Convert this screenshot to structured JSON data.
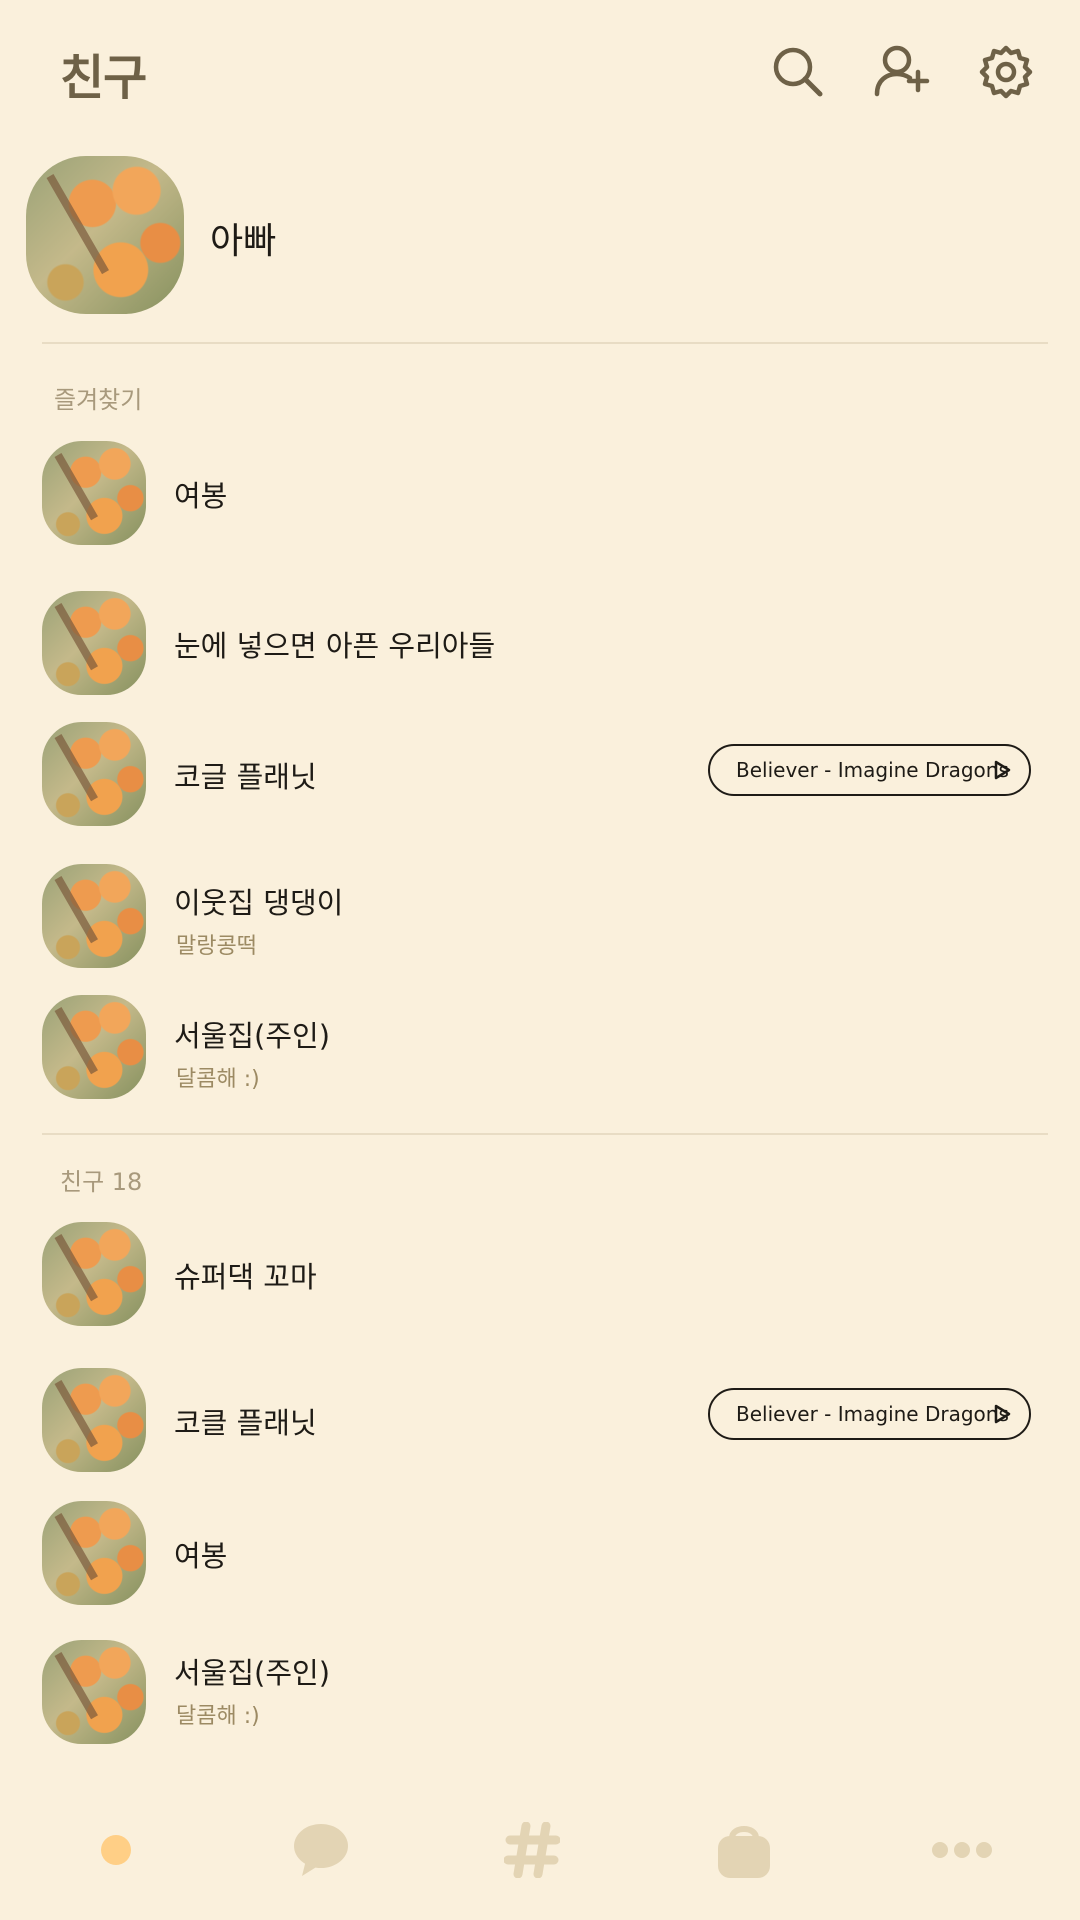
{
  "header": {
    "title": "친구",
    "icons": {
      "search": "search-icon",
      "add_friend": "add-friend-icon",
      "settings": "gear-icon"
    },
    "icon_color": "#6E6147"
  },
  "my_profile": {
    "name": "아빠"
  },
  "favorites": {
    "label": "즐겨찾기",
    "items": [
      {
        "name": "여봉",
        "status": "",
        "music": ""
      },
      {
        "name": "눈에 넣으면 아픈 우리아들",
        "status": "",
        "music": ""
      },
      {
        "name": "코글 플래닛",
        "status": "",
        "music": "Believer - Imagine Dragons"
      },
      {
        "name": "이웃집 댕댕이",
        "status": "말랑콩떡",
        "music": ""
      },
      {
        "name": "서울집(주인)",
        "status": "달콤해 :)",
        "music": ""
      }
    ]
  },
  "friends": {
    "label": "친구 18",
    "items": [
      {
        "name": "슈퍼댁 꼬마",
        "status": "",
        "music": ""
      },
      {
        "name": "코클 플래닛",
        "status": "",
        "music": "Believer - Imagine Dragons"
      },
      {
        "name": "여봉",
        "status": "",
        "music": ""
      },
      {
        "name": "서울집(주인)",
        "status": "달콤해 :)",
        "music": ""
      }
    ]
  },
  "bottom_nav": {
    "items": [
      "friends-tab-icon",
      "chat-tab-icon",
      "hashtag-tab-icon",
      "shopping-tab-icon",
      "more-tab-icon"
    ],
    "active_color": "#FFCF86",
    "inactive_color": "#E3D4B4"
  }
}
